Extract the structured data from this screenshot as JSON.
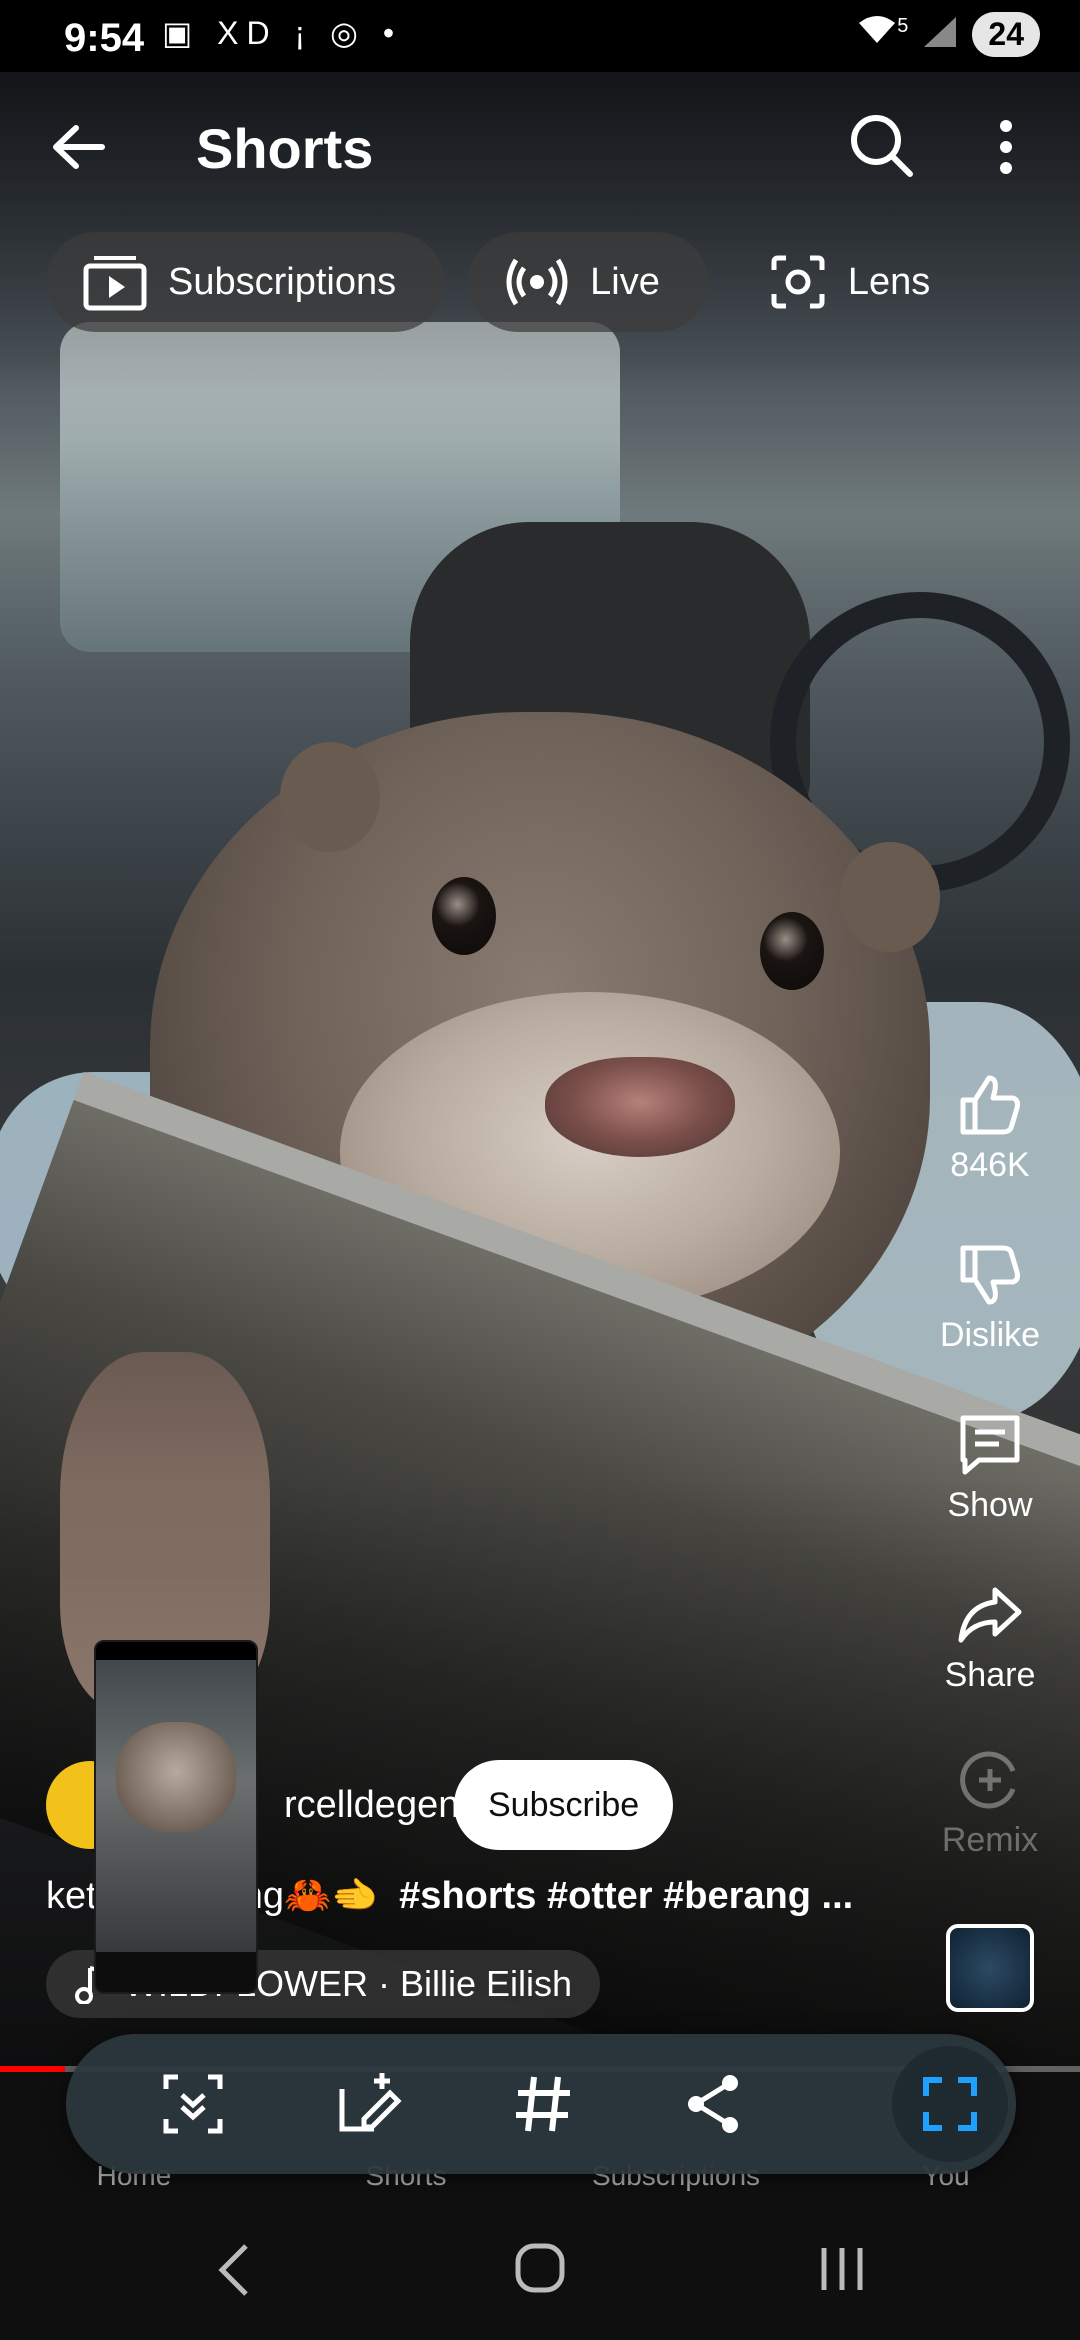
{
  "status_bar": {
    "time": "9:54",
    "left_icons": "▣ XD ¡ ◎ •",
    "wifi": "5",
    "battery": "24"
  },
  "header": {
    "title": "Shorts"
  },
  "chips": [
    {
      "label": "Subscriptions",
      "icon": "subscriptions-icon"
    },
    {
      "label": "Live",
      "icon": "live-icon"
    },
    {
      "label": "Lens",
      "icon": "lens-icon"
    }
  ],
  "rail": {
    "like_count": "846K",
    "dislike_label": "Dislike",
    "comments_label": "Show",
    "share_label": "Share",
    "remix_label": "Remix"
  },
  "channel": {
    "name": "rcelldegen",
    "subscribe_label": "Subscribe"
  },
  "caption": {
    "prefix": "ket",
    "middle": "ting🦀🫲",
    "tags": "#shorts #otter #berang ..."
  },
  "music": {
    "label": "WILDFLOWER · Billie Eilish"
  },
  "bottom_nav": {
    "home": "Home",
    "shorts": "Shorts",
    "subscriptions": "Subscriptions",
    "you": "You"
  },
  "progress": {
    "fraction": 0.06
  },
  "colors": {
    "accent": "#ff0000",
    "toolbar": "#2c383e",
    "active_tool": "#1ea0ff"
  }
}
